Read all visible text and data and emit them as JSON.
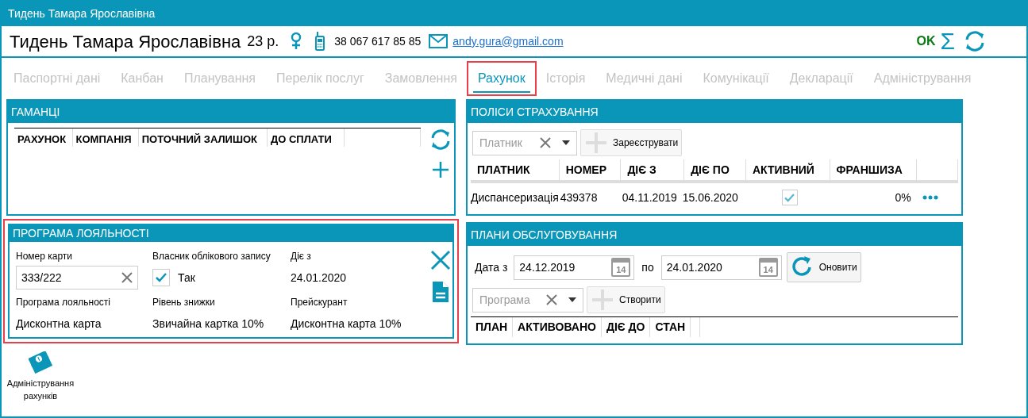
{
  "window": {
    "title": "Тидень Тамара Ярославівна"
  },
  "patient": {
    "name": "Тидень Тамара Ярославівна",
    "age": "23 р.",
    "phone": "38 067 617 85 85",
    "email": "andy.gura@gmail.com"
  },
  "status": {
    "text": "OK",
    "sum_symbol": "Σ"
  },
  "tabs": [
    {
      "label": "Паспортні дані",
      "selected": false,
      "highlighted": false
    },
    {
      "label": "Канбан",
      "selected": false,
      "highlighted": false
    },
    {
      "label": "Планування",
      "selected": false,
      "highlighted": false
    },
    {
      "label": "Перелік послуг",
      "selected": false,
      "highlighted": false
    },
    {
      "label": "Замовлення",
      "selected": false,
      "highlighted": false
    },
    {
      "label": "Рахунок",
      "selected": true,
      "highlighted": true
    },
    {
      "label": "Історія",
      "selected": false,
      "highlighted": false
    },
    {
      "label": "Медичні дані",
      "selected": false,
      "highlighted": false
    },
    {
      "label": "Комунікації",
      "selected": false,
      "highlighted": false
    },
    {
      "label": "Декларації",
      "selected": false,
      "highlighted": false
    },
    {
      "label": "Адміністрування",
      "selected": false,
      "highlighted": false
    }
  ],
  "wallets": {
    "title": "ГАМАНЦІ",
    "columns": [
      "РАХУНОК",
      "КОМПАНІЯ",
      "ПОТОЧНИЙ ЗАЛИШОК",
      "ДО СПЛАТИ"
    ]
  },
  "loyalty": {
    "title": "ПРОГРАМА ЛОЯЛЬНОСТІ",
    "highlighted": true,
    "fields": [
      {
        "kind": "input",
        "label": "Номер карти",
        "value": "333/222"
      },
      {
        "kind": "checkbox",
        "label": "Власник облікового запису",
        "value": "Так",
        "checked": true
      },
      {
        "kind": "text",
        "label": "Діє з",
        "value": "24.01.2020"
      },
      {
        "kind": "text",
        "label": "Програма лояльності",
        "value": "Дисконтна карта"
      },
      {
        "kind": "text",
        "label": "Рівень знижки",
        "value": "Звичайна картка 10%"
      },
      {
        "kind": "text",
        "label": "Прейскурант",
        "value": "Дисконтна карта 10%"
      }
    ]
  },
  "policies": {
    "title": "ПОЛІСИ СТРАХУВАННЯ",
    "payer_filter": {
      "placeholder": "Платник"
    },
    "register_button": "Зареєструвати",
    "columns": [
      "ПЛАТНИК",
      "НОМЕР",
      "ДІЄ З",
      "ДІЄ ПО",
      "АКТИВНИЙ",
      "ФРАНШИЗА"
    ],
    "rows": [
      {
        "payer": "Диспансеризація",
        "number": "439378",
        "from": "04.11.2019",
        "to": "15.06.2020",
        "active": true,
        "franchise": "0%"
      }
    ]
  },
  "plans": {
    "title": "ПЛАНИ ОБСЛУГОВУВАННЯ",
    "date_from_label": "Дата з",
    "date_from": "24.12.2019",
    "date_from_day": "14",
    "to_label": "по",
    "date_to": "24.01.2020",
    "date_to_day": "14",
    "refresh_button": "Оновити",
    "program_filter": {
      "placeholder": "Програма"
    },
    "create_button": "Створити",
    "columns": [
      "ПЛАН",
      "АКТИВОВАНО",
      "ДІЄ ДО",
      "СТАН"
    ]
  },
  "footer_tool": {
    "label": "Адміністрування рахунків"
  }
}
